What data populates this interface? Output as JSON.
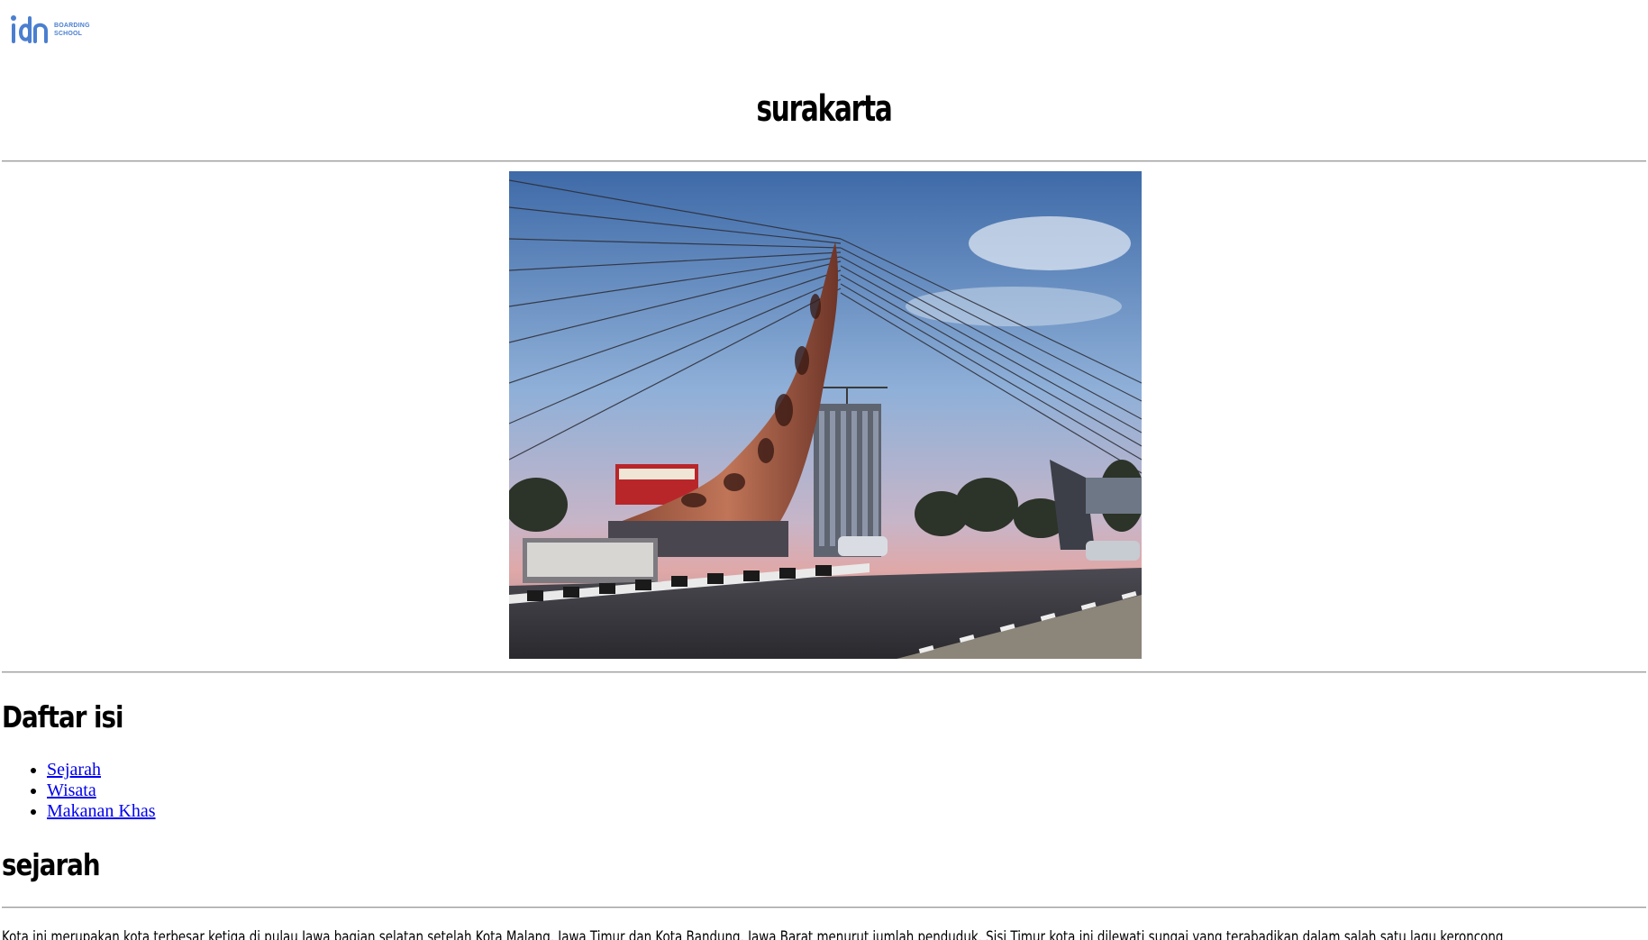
{
  "header": {
    "logo": {
      "icon": "idn-logo-icon",
      "brand_color": "#4a7fd0",
      "line1": "BOARDING",
      "line2": "SCHOOL"
    }
  },
  "main": {
    "title": "surakarta",
    "hero_image": {
      "alt": "surakarta"
    },
    "toc": {
      "heading": "Daftar isi",
      "items": [
        {
          "label": "Sejarah"
        },
        {
          "label": "Wisata"
        },
        {
          "label": "Makanan Khas"
        }
      ]
    },
    "sections": {
      "sejarah": {
        "heading": "sejarah",
        "paragraph": "Kota ini merupakan kota terbesar ketiga di pulau Jawa bagian selatan setelah Kota Malang, Jawa Timur dan Kota Bandung, Jawa Barat menurut jumlah penduduk. Sisi Timur kota ini dilewati sungai yang terabadikan dalam salah satu lagu keroncong"
      }
    }
  },
  "colors": {
    "link": "#0000ee",
    "rule": "#9a9a9a",
    "text": "#000000"
  }
}
